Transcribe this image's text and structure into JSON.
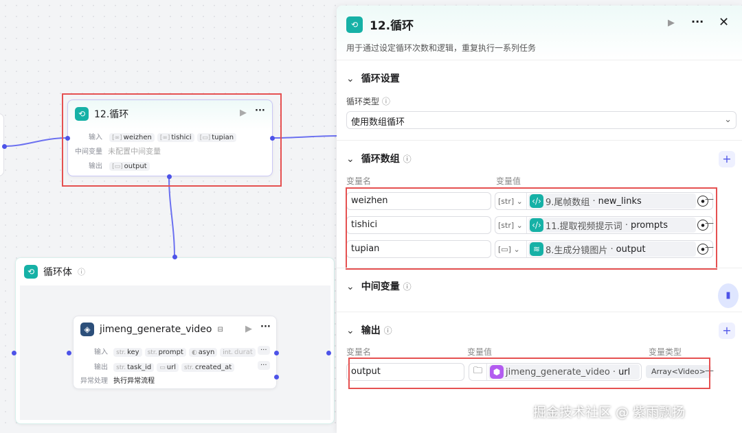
{
  "canvas": {
    "loop_node": {
      "title": "12.循环",
      "input_label": "输入",
      "inputs": [
        "weizhen",
        "tishici",
        "tupian"
      ],
      "mid_label": "中间变量",
      "mid_value": "未配置中间变量",
      "output_label": "输出",
      "outputs": [
        "output"
      ]
    },
    "loop_body": {
      "title": "循环体"
    },
    "video_node": {
      "title": "jimeng_generate_video",
      "input_label": "输入",
      "inputs": [
        {
          "type": "str.",
          "name": "key"
        },
        {
          "type": "str.",
          "name": "prompt"
        },
        {
          "type": "◐",
          "name": "asyn"
        },
        {
          "type": "int.",
          "name": "durat"
        }
      ],
      "output_label": "输出",
      "outputs": [
        {
          "type": "str.",
          "name": "task_id"
        },
        {
          "type": "▭",
          "name": "url"
        },
        {
          "type": "str.",
          "name": "created_at"
        }
      ],
      "error_label": "异常处理",
      "error_value": "执行异常流程"
    }
  },
  "panel": {
    "title": "12.循环",
    "description": "用于通过设定循环次数和逻辑，重复执行一系列任务",
    "loop_settings": {
      "title": "循环设置",
      "type_label": "循环类型",
      "type_value": "使用数组循环"
    },
    "loop_array": {
      "title": "循环数组",
      "col_name": "变量名",
      "col_value": "变量值",
      "rows": [
        {
          "name": "weizhen",
          "type": "[str]",
          "source": "9.尾帧数组",
          "field": "new_links",
          "icon": "code-icon"
        },
        {
          "name": "tishici",
          "type": "[str]",
          "source": "11.提取视频提示词",
          "field": "prompts",
          "icon": "code-icon"
        },
        {
          "name": "tupian",
          "type": "[▭]",
          "source": "8.生成分镜图片",
          "field": "output",
          "icon": "layers-icon"
        }
      ]
    },
    "mid_vars": {
      "title": "中间变量"
    },
    "output": {
      "title": "输出",
      "col_name": "变量名",
      "col_value": "变量值",
      "col_type": "变量类型",
      "rows": [
        {
          "name": "output",
          "source": "jimeng_generate_video",
          "field": "url",
          "type": "Array<Video>"
        }
      ]
    }
  },
  "watermark": "掘金技术社区 @ 紫雨飘扬",
  "colors": {
    "accent": "#4d53e8",
    "teal": "#16b1a6",
    "highlight": "#e55050",
    "purple": "#b35cf0"
  }
}
